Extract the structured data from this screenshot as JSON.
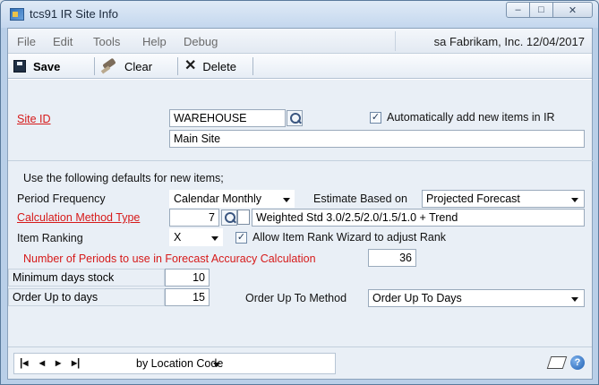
{
  "window": {
    "title": "tcs91 IR Site Info"
  },
  "menu": {
    "items": [
      "File",
      "Edit",
      "Tools",
      "Help",
      "Debug"
    ],
    "user_info": "sa  Fabrikam, Inc. 12/04/2017"
  },
  "toolbar": {
    "save_label": "Save",
    "clear_label": "Clear",
    "delete_label": "Delete"
  },
  "form": {
    "site_id_label": "Site ID",
    "site_id_value": "WAREHOUSE",
    "site_name": "Main Site",
    "auto_add_label": "Automatically add new items in IR",
    "auto_add_checked": true,
    "defaults_heading": "Use the following defaults for new items;",
    "period_frequency_label": "Period Frequency",
    "period_frequency_value": "Calendar Monthly",
    "estimate_based_label": "Estimate Based on",
    "estimate_based_value": "Projected Forecast",
    "calc_method_label": "Calculation Method Type",
    "calc_method_id": "7",
    "calc_method_desc": "Weighted Std 3.0/2.5/2.0/1.5/1.0 + Trend",
    "item_ranking_label": "Item Ranking",
    "item_ranking_value": "X",
    "rank_wizard_label": "Allow Item Rank Wizard to adjust Rank",
    "rank_wizard_checked": true,
    "periods_label": "Number of Periods to use in  Forecast Accuracy Calculation",
    "periods_value": "36",
    "min_days_label": "Minimum days stock",
    "min_days_value": "10",
    "order_up_to_days_label": "Order Up to days",
    "order_up_to_days_value": "15",
    "order_up_method_label": "Order Up To Method",
    "order_up_method_value": "Order Up To Days"
  },
  "status": {
    "sort_value": "by Location Code"
  },
  "colors": {
    "required_label": "#d61a1a",
    "panel_bg": "#e9eff6"
  }
}
